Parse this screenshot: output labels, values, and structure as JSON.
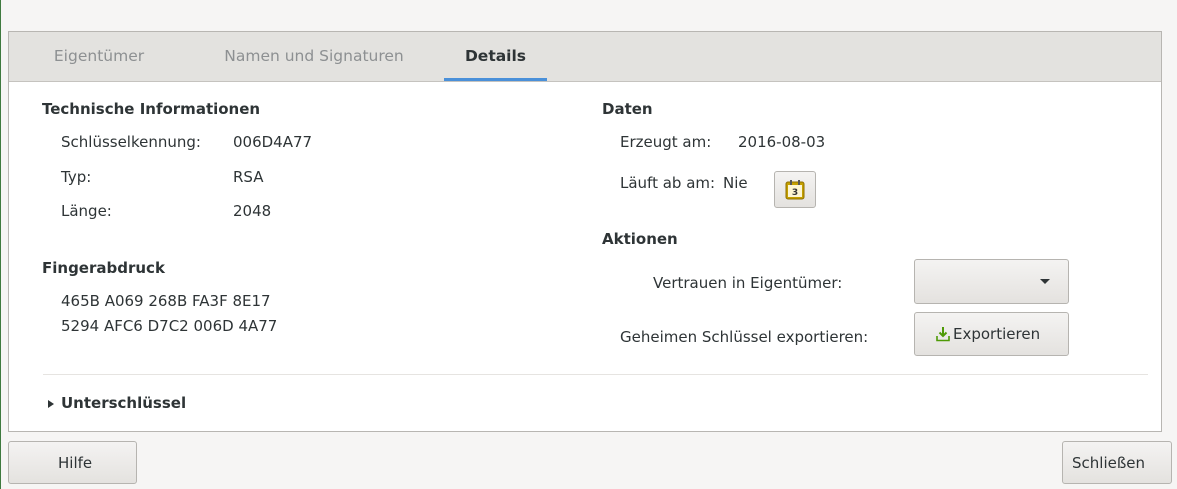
{
  "tabs": [
    {
      "label": "Eigentümer"
    },
    {
      "label": "Namen und Signaturen"
    },
    {
      "label": "Details"
    }
  ],
  "technical": {
    "heading": "Technische Informationen",
    "key_id_label": "Schlüsselkennung:",
    "key_id_value": "006D4A77",
    "type_label": "Typ:",
    "type_value": "RSA",
    "length_label": "Länge:",
    "length_value": "2048"
  },
  "fingerprint": {
    "heading": "Fingerabdruck",
    "line1": "465B A069 268B FA3F 8E17",
    "line2": "5294 AFC6 D7C2 006D 4A77"
  },
  "dates": {
    "heading": "Daten",
    "created_label": "Erzeugt am:",
    "created_value": "2016-08-03",
    "expires_label": "Läuft ab am:",
    "expires_value": "Nie"
  },
  "actions": {
    "heading": "Aktionen",
    "trust_label": "Vertrauen in Eigentümer:",
    "trust_value": "",
    "export_label": "Geheimen Schlüssel exportieren:",
    "export_button": "Exportieren"
  },
  "subkeys": {
    "label": "Unterschlüssel"
  },
  "footer": {
    "help_button": "Hilfe",
    "close_button": "Schließen"
  },
  "colors": {
    "tab_underline": "#4a90d9",
    "export_icon": "#4e9a06",
    "calendar_icon": "#c4a000"
  }
}
